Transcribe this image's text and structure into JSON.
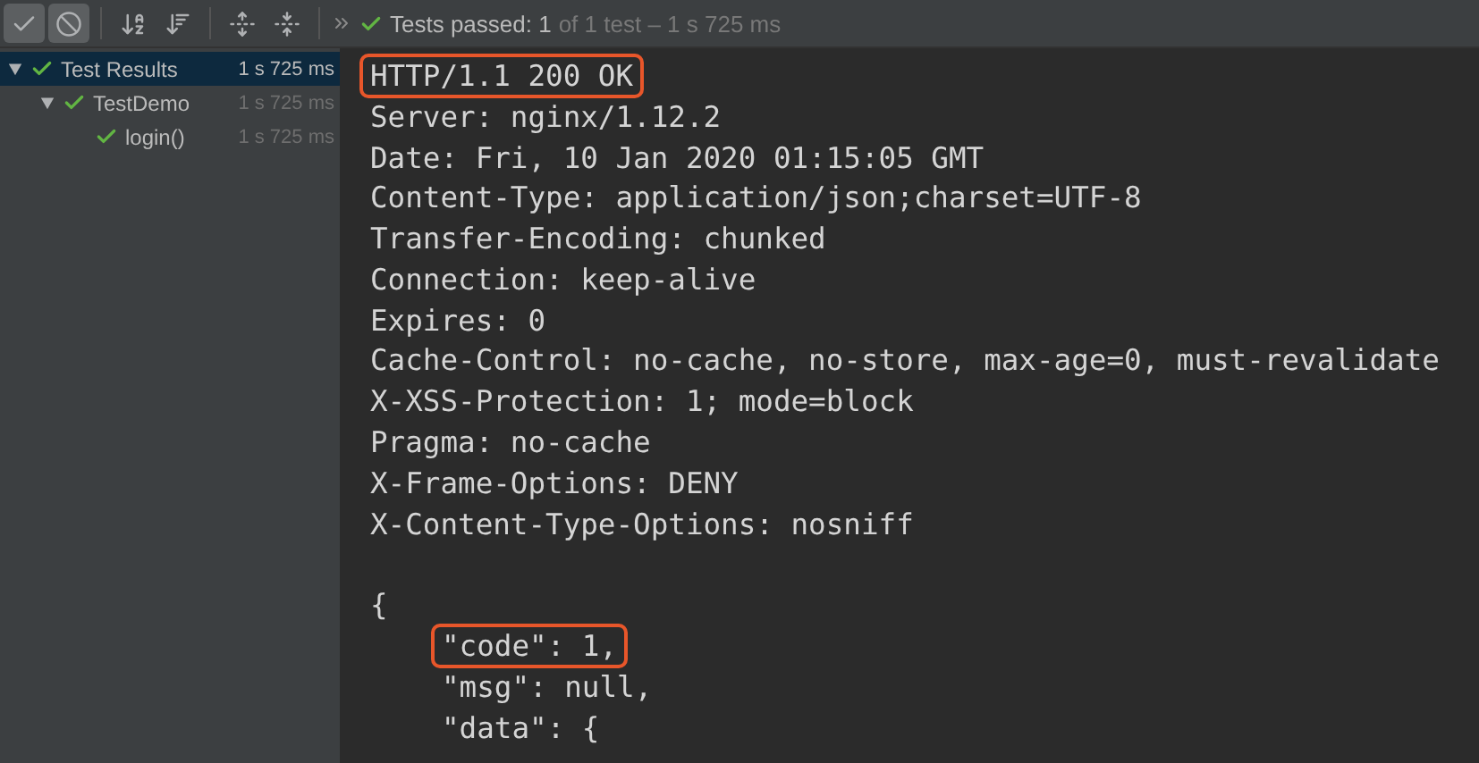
{
  "toolbar": {
    "buttons": [
      {
        "kind": "show-passed",
        "selected": true
      },
      {
        "kind": "show-ignored",
        "selected": true
      },
      {
        "kind": "sort-alpha",
        "selected": false
      },
      {
        "kind": "sort-duration",
        "selected": false
      },
      {
        "kind": "expand-all",
        "selected": false
      },
      {
        "kind": "collapse-all",
        "selected": false
      }
    ],
    "status": {
      "summary": "Tests passed: 1",
      "detail": "of 1 test – 1 s 725 ms"
    }
  },
  "tree": [
    {
      "label": "Test Results",
      "time": "1 s 725 ms",
      "selected": true,
      "expanded": true,
      "children": [
        {
          "label": "TestDemo",
          "time": "1 s 725 ms",
          "selected": false,
          "expanded": true,
          "children": [
            {
              "label": "login()",
              "time": "1 s 725 ms",
              "selected": false
            }
          ]
        }
      ]
    }
  ],
  "console": [
    {
      "kind": "text",
      "text": "HTTP/1.1 200 OK",
      "highlighted": true
    },
    {
      "kind": "text",
      "text": "Server: nginx/1.12.2",
      "highlighted": false
    },
    {
      "kind": "text",
      "text": "Date: Fri, 10 Jan 2020 01:15:05 GMT",
      "highlighted": false
    },
    {
      "kind": "text",
      "text": "Content-Type: application/json;charset=UTF-8",
      "highlighted": false
    },
    {
      "kind": "text",
      "text": "Transfer-Encoding: chunked",
      "highlighted": false
    },
    {
      "kind": "text",
      "text": "Connection: keep-alive",
      "highlighted": false
    },
    {
      "kind": "text",
      "text": "Expires: 0",
      "highlighted": false
    },
    {
      "kind": "text",
      "text": "Cache-Control: no-cache, no-store, max-age=0, must-revalidate",
      "highlighted": false
    },
    {
      "kind": "text",
      "text": "X-XSS-Protection: 1; mode=block",
      "highlighted": false
    },
    {
      "kind": "text",
      "text": "Pragma: no-cache",
      "highlighted": false
    },
    {
      "kind": "text",
      "text": "X-Frame-Options: DENY",
      "highlighted": false
    },
    {
      "kind": "text",
      "text": "X-Content-Type-Options: nosniff",
      "highlighted": false
    },
    {
      "kind": "blank"
    },
    {
      "kind": "text",
      "text": "{",
      "highlighted": false,
      "children": [
        {
          "kind": "text",
          "text": "\"code\": 1,",
          "highlighted": true
        },
        {
          "kind": "text",
          "text": "\"msg\": null,",
          "highlighted": false
        },
        {
          "kind": "text",
          "text": "\"data\": {",
          "highlighted": false
        }
      ]
    }
  ]
}
